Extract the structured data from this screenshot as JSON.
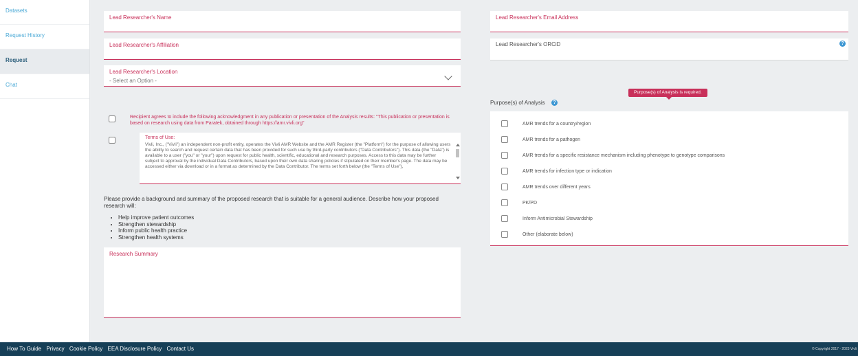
{
  "sidebar": {
    "items": [
      {
        "label": "Datasets"
      },
      {
        "label": "Request History"
      },
      {
        "label": "Request"
      },
      {
        "label": "Chat"
      }
    ]
  },
  "form": {
    "name_label": "Lead Researcher's Name",
    "email_label": "Lead Researcher's Email Address",
    "affiliation_label": "Lead Researcher's Affiliation",
    "orcid_label": "Lead Researcher's ORCiD",
    "location_label": "Lead Researcher's Location",
    "location_value": "- Select an Option -",
    "acknowledgment": "Recipient agrees to include the following acknowledgment in any publication or presentation of the Analysis results: \"This publication or presentation is based on research using data from Paratek, obtained through https://amr.vivli.org\"",
    "terms_label": "Terms of Use:",
    "terms_text": "Vivli, Inc., (\"Vivli\") an independent non-profit entity, operates the Vivli AMR Website and the AMR Register (the \"Platform\") for the purpose of allowing users the ability to search and request certain data that has been provided for such use by third-party contributors (\"Data Contributors\"). This data (the \"Data\") is available to a user (\"you\" or \"your\") upon request for public health, scientific, educational and research purposes. Access to this data may be further subject to approval by the individual Data Contributors, based upon their own data sharing policies if stipulated on their member's page. The data may be accessed either via download or in a format as determined by the Data Contributor. The terms set forth below (the \"Terms of Use\"),",
    "summary_prompt": "Please provide a background and summary of the proposed research that is suitable for a general audience. Describe how your proposed research will:",
    "bullets": [
      "Help improve patient outcomes",
      "Strengthen stewardship",
      "Inform public health practice",
      "Strengthen health systems"
    ],
    "summary_label": "Research Summary"
  },
  "purpose": {
    "title": "Purpose(s) of Analysis",
    "error_tooltip": "Purpose(s) of Analysis is required.",
    "options": [
      "AMR trends for a country/region",
      "AMR trends for a pathogen",
      "AMR trends for a specific resistance mechanism including phenotype to genotype comparisons",
      "AMR trends for infection type or indication",
      "AMR trends over different years",
      "PK/PD",
      "Inform Antimicrobial Stewardship",
      "Other (elaborate below)"
    ]
  },
  "footer": {
    "links": [
      "How To Guide",
      "Privacy",
      "Cookie Policy",
      "EEA Disclosure Policy",
      "Contact Us"
    ],
    "copyright": "© Copyright 2017 - 2023 Vivli"
  },
  "colors": {
    "accent": "#c8305a",
    "footer": "#163f57",
    "link": "#4aa9d6"
  }
}
